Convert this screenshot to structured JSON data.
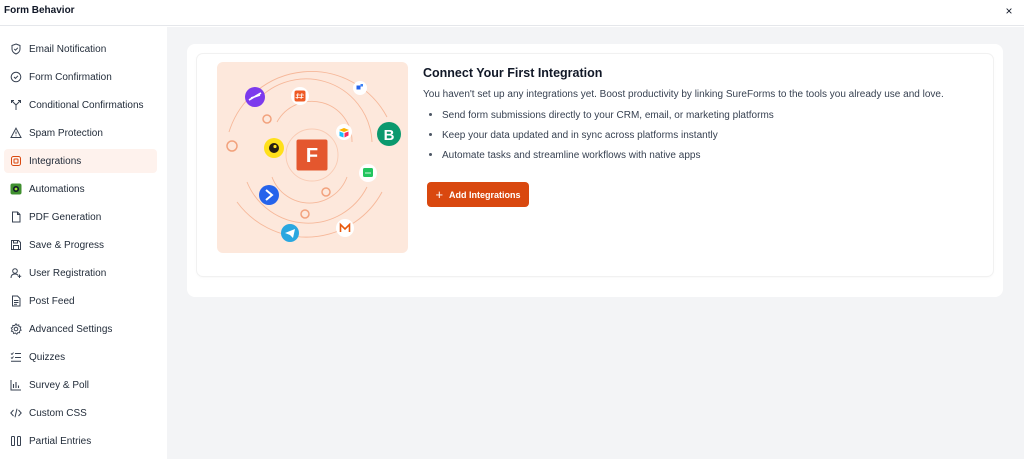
{
  "window": {
    "title": "Form Behavior",
    "close_glyph": "×"
  },
  "sidebar": {
    "items": [
      {
        "label": "Email Notification",
        "icon": "shield-icon",
        "active": false
      },
      {
        "label": "Form Confirmation",
        "icon": "check-circle-icon",
        "active": false
      },
      {
        "label": "Conditional Confirmations",
        "icon": "branch-icon",
        "active": false
      },
      {
        "label": "Spam Protection",
        "icon": "warning-triangle-icon",
        "active": false
      },
      {
        "label": "Integrations",
        "icon": "integration-icon",
        "active": true
      },
      {
        "label": "Automations",
        "icon": "automation-icon",
        "active": false
      },
      {
        "label": "PDF Generation",
        "icon": "file-icon",
        "active": false
      },
      {
        "label": "Save & Progress",
        "icon": "save-icon",
        "active": false
      },
      {
        "label": "User Registration",
        "icon": "user-plus-icon",
        "active": false
      },
      {
        "label": "Post Feed",
        "icon": "document-icon",
        "active": false
      },
      {
        "label": "Advanced Settings",
        "icon": "gear-icon",
        "active": false
      },
      {
        "label": "Quizzes",
        "icon": "list-check-icon",
        "active": false
      },
      {
        "label": "Survey & Poll",
        "icon": "bar-chart-icon",
        "active": false
      },
      {
        "label": "Custom CSS",
        "icon": "code-icon",
        "active": false
      },
      {
        "label": "Partial Entries",
        "icon": "columns-icon",
        "active": false
      }
    ]
  },
  "main": {
    "heading": "Connect Your First Integration",
    "description": "You haven't set up any integrations yet. Boost productivity by linking SureForms to the tools you already use and love.",
    "bullets": [
      "Send form submissions directly to your CRM, email, or marketing platforms",
      "Keep your data updated and in sync across platforms instantly",
      "Automate tasks and streamline workflows with native apps"
    ],
    "add_button_label": "Add Integrations",
    "illustration_center_letter": "F",
    "illustration_letter_b": "B"
  },
  "colors": {
    "accent": "#d9480f",
    "active_bg": "#fef2ed",
    "main_bg": "#f3f4f6",
    "illustration_bg": "#fde8dc"
  }
}
